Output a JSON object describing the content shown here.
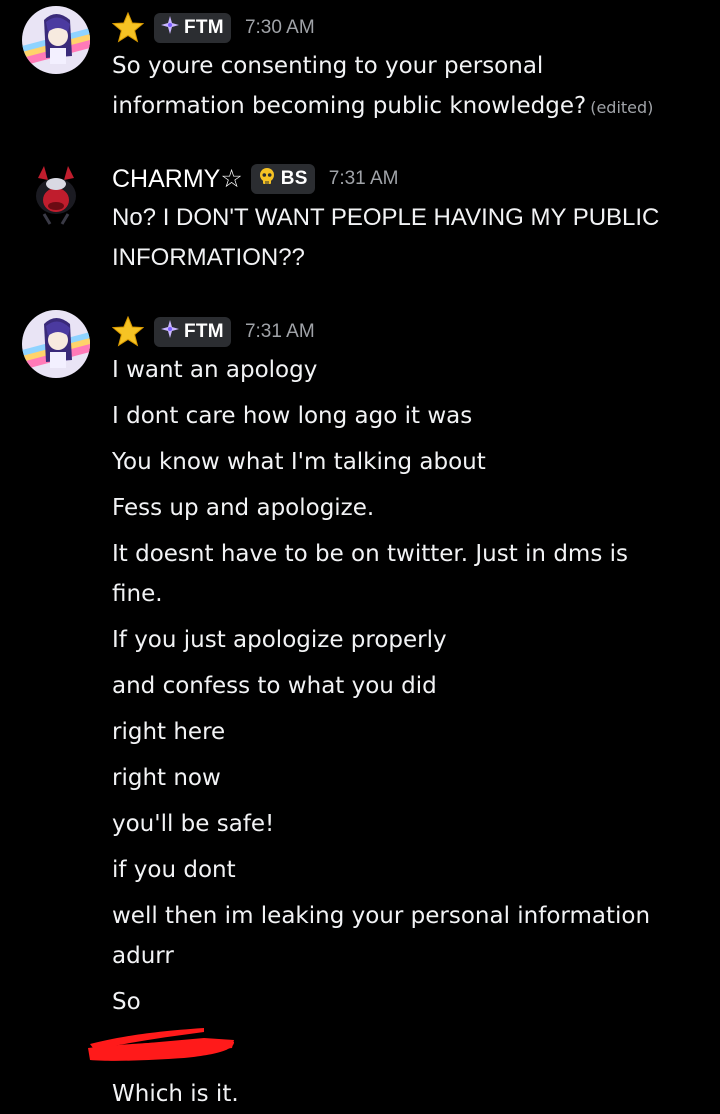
{
  "colors": {
    "background": "#000000",
    "text": "#f2f3f5",
    "muted": "#a0a3a8",
    "tag_bg": "#2b2d31",
    "star": "#f6c324",
    "redaction": "#ff1a1a"
  },
  "messages": [
    {
      "user_icon": "star-icon",
      "tag_icon": "sparkle-icon",
      "tag": "FTM",
      "time": "7:30 AM",
      "lines": [
        "So youre consenting to your personal",
        "information becoming public knowledge?"
      ],
      "edited": "(edited)"
    },
    {
      "username": "CHARMY☆",
      "tag_icon": "skull-icon",
      "tag": "BS",
      "time": "7:31 AM",
      "lines": [
        "No? I DON'T WANT PEOPLE HAVING MY PUBLIC",
        "INFORMATION??"
      ]
    },
    {
      "user_icon": "star-icon",
      "tag_icon": "sparkle-icon",
      "tag": "FTM",
      "time": "7:31 AM",
      "lines": [
        "I want an apology",
        "I dont care how long ago it was",
        "You know what I'm talking about",
        "Fess up and apologize.",
        "It doesnt have to be on twitter. Just in dms is",
        "fine.",
        "If you just apologize properly",
        "and confess to what you did",
        "right here",
        "right now",
        "you'll be safe!",
        "if you dont",
        "well then im leaking your personal information",
        "adurr",
        "So",
        "Which is it."
      ]
    }
  ]
}
